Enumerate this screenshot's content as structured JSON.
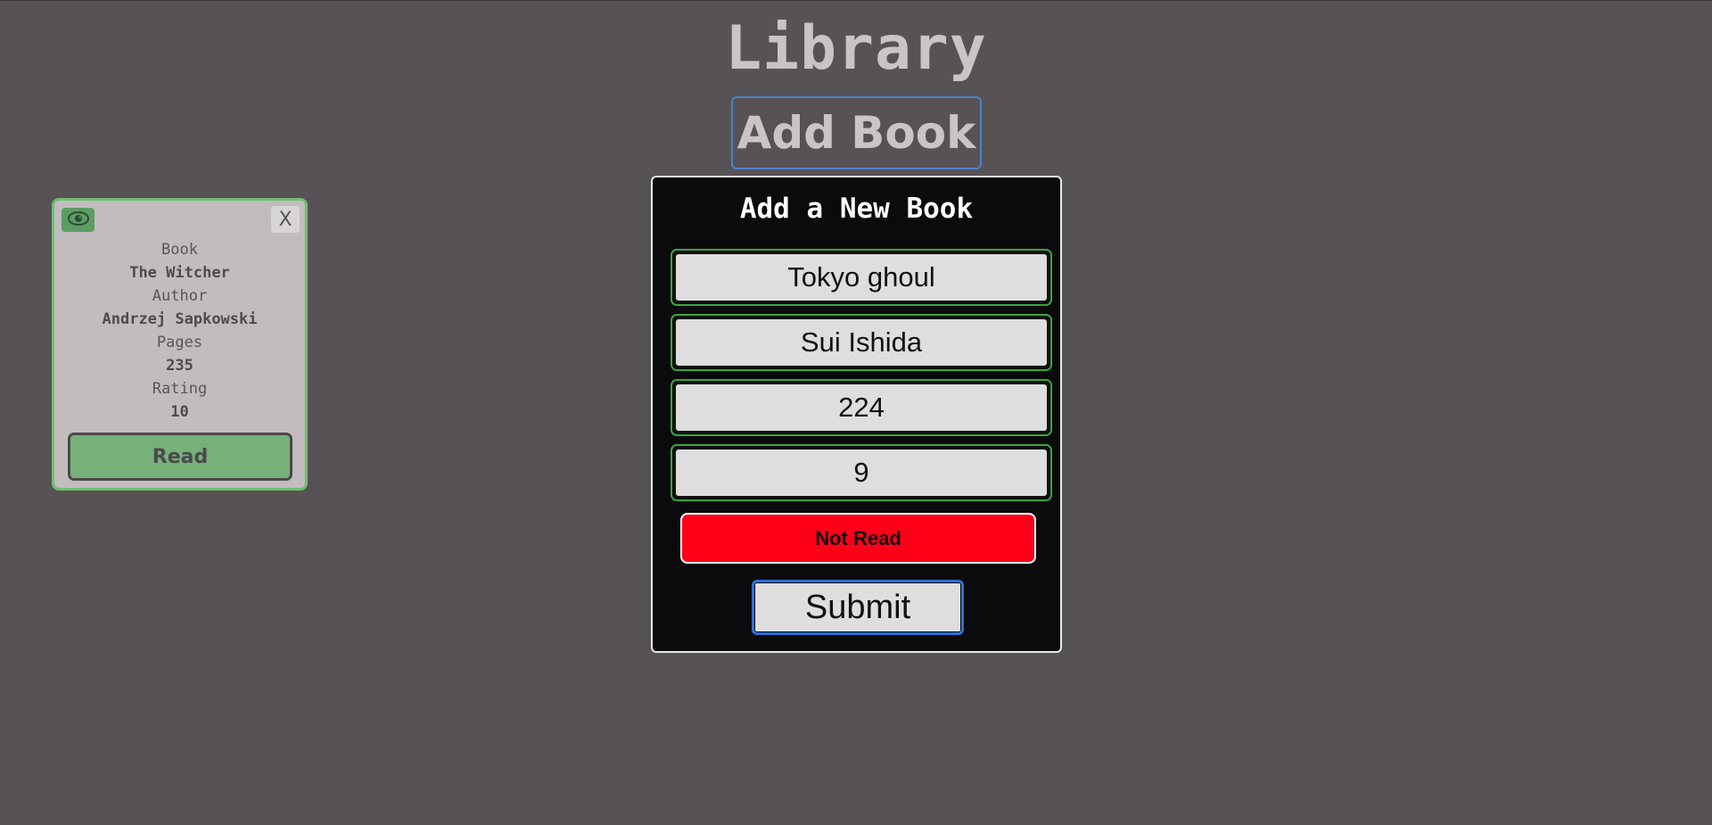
{
  "header": {
    "title": "Library",
    "add_book_label": "Add Book"
  },
  "book_card": {
    "eye_icon": "eye-icon",
    "close_label": "X",
    "book_label": "Book",
    "book_value": "The Witcher",
    "author_label": "Author",
    "author_value": "Andrzej Sapkowski",
    "pages_label": "Pages",
    "pages_value": "235",
    "rating_label": "Rating",
    "rating_value": "10",
    "status_label": "Read"
  },
  "modal": {
    "title": "Add a New Book",
    "title_value": "Tokyo ghoul",
    "author_value": "Sui Ishida",
    "pages_value": "224",
    "rating_value": "9",
    "status_label": "Not Read",
    "submit_label": "Submit"
  },
  "colors": {
    "background": "#575256",
    "card_border": "#6fbf6f",
    "read_green": "#78b07a",
    "not_read_red": "#ff0019",
    "accent_blue": "#4f7fc9"
  }
}
